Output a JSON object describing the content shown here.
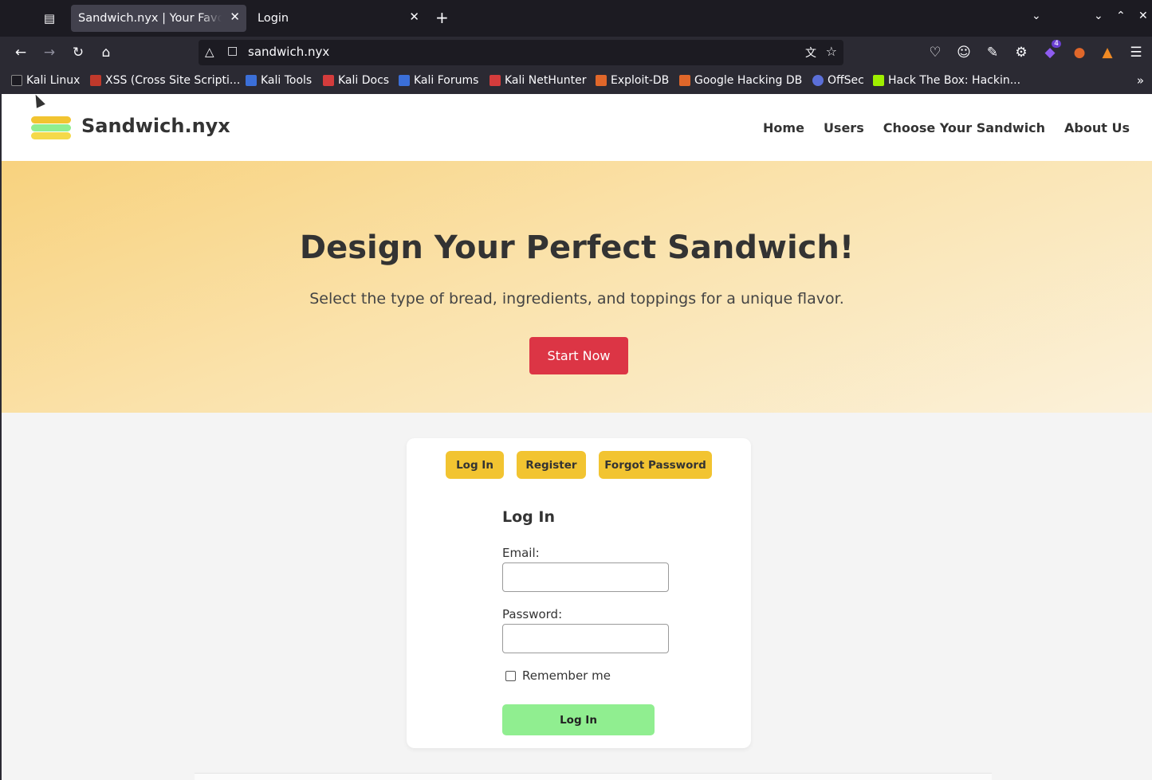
{
  "browser": {
    "tabs": [
      {
        "label": "Sandwich.nyx | Your Favori",
        "active": true
      },
      {
        "label": "Login",
        "active": false
      }
    ],
    "url": "sandwich.nyx",
    "extension_badge": "4",
    "bookmarks": [
      {
        "label": "Kali Linux",
        "color": "#1c1b22"
      },
      {
        "label": "XSS (Cross Site Scripti...",
        "color": "#c0392b"
      },
      {
        "label": "Kali Tools",
        "color": "#3b6fd8"
      },
      {
        "label": "Kali Docs",
        "color": "#d43c3c"
      },
      {
        "label": "Kali Forums",
        "color": "#3b6fd8"
      },
      {
        "label": "Kali NetHunter",
        "color": "#d43c3c"
      },
      {
        "label": "Exploit-DB",
        "color": "#e0672a"
      },
      {
        "label": "Google Hacking DB",
        "color": "#e0672a"
      },
      {
        "label": "OffSec",
        "color": "#5b6fd8"
      },
      {
        "label": "Hack The Box: Hackin...",
        "color": "#9fef00"
      }
    ]
  },
  "site": {
    "brand": "Sandwich.nyx",
    "logo_colors": [
      "#f2c431",
      "#90ee90",
      "#f5d94a"
    ],
    "nav": [
      "Home",
      "Users",
      "Choose Your Sandwich",
      "About Us"
    ],
    "hero": {
      "title": "Design Your Perfect Sandwich!",
      "subtitle": "Select the type of bread, ingredients, and toppings for a unique flavor.",
      "cta": "Start Now"
    },
    "auth_tabs": [
      "Log In",
      "Register",
      "Forgot Password"
    ],
    "form": {
      "title": "Log In",
      "email_label": "Email:",
      "email_value": "",
      "password_label": "Password:",
      "password_value": "",
      "remember_label": "Remember me",
      "submit": "Log In"
    }
  }
}
